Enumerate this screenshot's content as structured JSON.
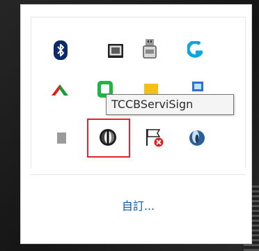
{
  "tray": {
    "customize_label": "自訂...",
    "tooltip_text": "TCCBServiSign"
  },
  "icons": [
    {
      "name": "bluetooth-icon",
      "row": 1,
      "col": 1
    },
    {
      "name": "tablet-icon",
      "row": 1,
      "col": 2
    },
    {
      "name": "usb-drive-icon",
      "row": 1,
      "col": 3
    },
    {
      "name": "logitech-g-icon",
      "row": 1,
      "col": 4
    },
    {
      "name": "red-green-wing-icon",
      "row": 2,
      "col": 1
    },
    {
      "name": "green-chat-icon",
      "row": 2,
      "col": 2
    },
    {
      "name": "yellow-note-icon",
      "row": 2,
      "col": 3
    },
    {
      "name": "blue-app-icon",
      "row": 2,
      "col": 4
    },
    {
      "name": "gray-square-icon",
      "row": 3,
      "col": 1
    },
    {
      "name": "tccb-servisign-icon",
      "row": 3,
      "col": 2,
      "selected": true
    },
    {
      "name": "flag-error-icon",
      "row": 3,
      "col": 3
    },
    {
      "name": "blue-sphere-icon",
      "row": 3,
      "col": 4
    }
  ],
  "colors": {
    "highlight_border": "#e0242a",
    "link": "#0b57b4"
  }
}
